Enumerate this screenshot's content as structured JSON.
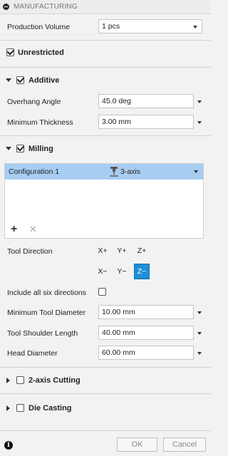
{
  "panel": {
    "title": "MANUFACTURING"
  },
  "production_volume": {
    "label": "Production Volume",
    "value": "1 pcs"
  },
  "unrestricted": {
    "label": "Unrestricted",
    "checked": true
  },
  "additive": {
    "label": "Additive",
    "checked": true,
    "overhang_angle": {
      "label": "Overhang Angle",
      "value": "45.0 deg"
    },
    "minimum_thickness": {
      "label": "Minimum Thickness",
      "value": "3.00 mm"
    }
  },
  "milling": {
    "label": "Milling",
    "checked": true,
    "configuration": {
      "name": "Configuration 1",
      "type": "3-axis"
    },
    "add_label": "+",
    "remove_label": "✕",
    "tool_direction": {
      "label": "Tool Direction",
      "buttons": [
        "X+",
        "Y+",
        "Z+",
        "X−",
        "Y−",
        "Z−"
      ],
      "active": "Z−"
    },
    "include_all_six": {
      "label": "Include all six directions",
      "checked": false
    },
    "minimum_tool_diameter": {
      "label": "Minimum Tool Diameter",
      "value": "10.00 mm"
    },
    "tool_shoulder_length": {
      "label": "Tool Shoulder Length",
      "value": "40.00 mm"
    },
    "head_diameter": {
      "label": "Head Diameter",
      "value": "60.00 mm"
    }
  },
  "two_axis_cutting": {
    "label": "2-axis Cutting",
    "checked": false
  },
  "die_casting": {
    "label": "Die Casting",
    "checked": false
  },
  "footer": {
    "ok_label": "OK",
    "cancel_label": "Cancel",
    "info_icon": "i"
  },
  "colors": {
    "accent": "#1e8fd6",
    "selection": "#a8cdf2"
  }
}
